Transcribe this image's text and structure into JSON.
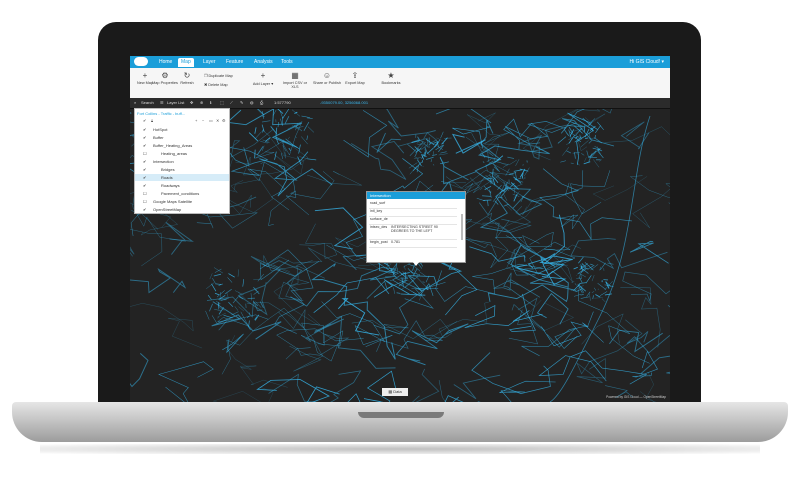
{
  "nav": {
    "tabs": [
      {
        "label": "Home"
      },
      {
        "label": "Map"
      },
      {
        "label": "Layer"
      },
      {
        "label": "Feature"
      },
      {
        "label": "Analysis"
      },
      {
        "label": "Tools"
      }
    ],
    "user": "Hi GIS Cloud! ▾"
  },
  "ribbon": {
    "new_map": "New Map",
    "map_properties": "Map Properties",
    "refresh": "Refresh",
    "duplicate_map": "Duplicate Map",
    "delete_map": "Delete Map",
    "add_layer": "Add Layer",
    "import": "Import CSV or XLS",
    "share": "Share or Publish",
    "export": "Export Map",
    "bookmarks": "Bookmarks"
  },
  "toolbar": {
    "search": "Search",
    "layer_list": "Layer List",
    "scale": "1:577790",
    "coords": "-9350079.00, 3256068.001"
  },
  "layers_panel": {
    "title": "Fort Collins - Traffic - buff...",
    "items": [
      {
        "label": "HotSpot"
      },
      {
        "label": "Buffer"
      },
      {
        "label": "Buffer_Heating_Areas"
      },
      {
        "label": "Heating_areas"
      },
      {
        "label": "Intersection"
      },
      {
        "label": "Bridges"
      },
      {
        "label": "Roads"
      },
      {
        "label": "Roadways"
      },
      {
        "label": "Pavement_conditions"
      },
      {
        "label": "Google Maps Satellite"
      },
      {
        "label": "OpenStreetMap"
      }
    ]
  },
  "popup": {
    "title": "Intersection",
    "rows": [
      {
        "key": "road_surf",
        "value": ""
      },
      {
        "key": "intl_key",
        "value": ""
      },
      {
        "key": "surface_de",
        "value": ""
      },
      {
        "key": "intsec_des",
        "value": "INTERSECTING STREET 90 DEGREES TO THE LEFT"
      },
      {
        "key": "begin_post",
        "value": "0.781"
      }
    ]
  },
  "stats_button": "Data",
  "attribution": "Powered by GIS Cloud — OpenStreetMap",
  "colors": {
    "accent": "#1b9ed9",
    "map_bg": "#232323",
    "roads": "#36b8ee"
  }
}
